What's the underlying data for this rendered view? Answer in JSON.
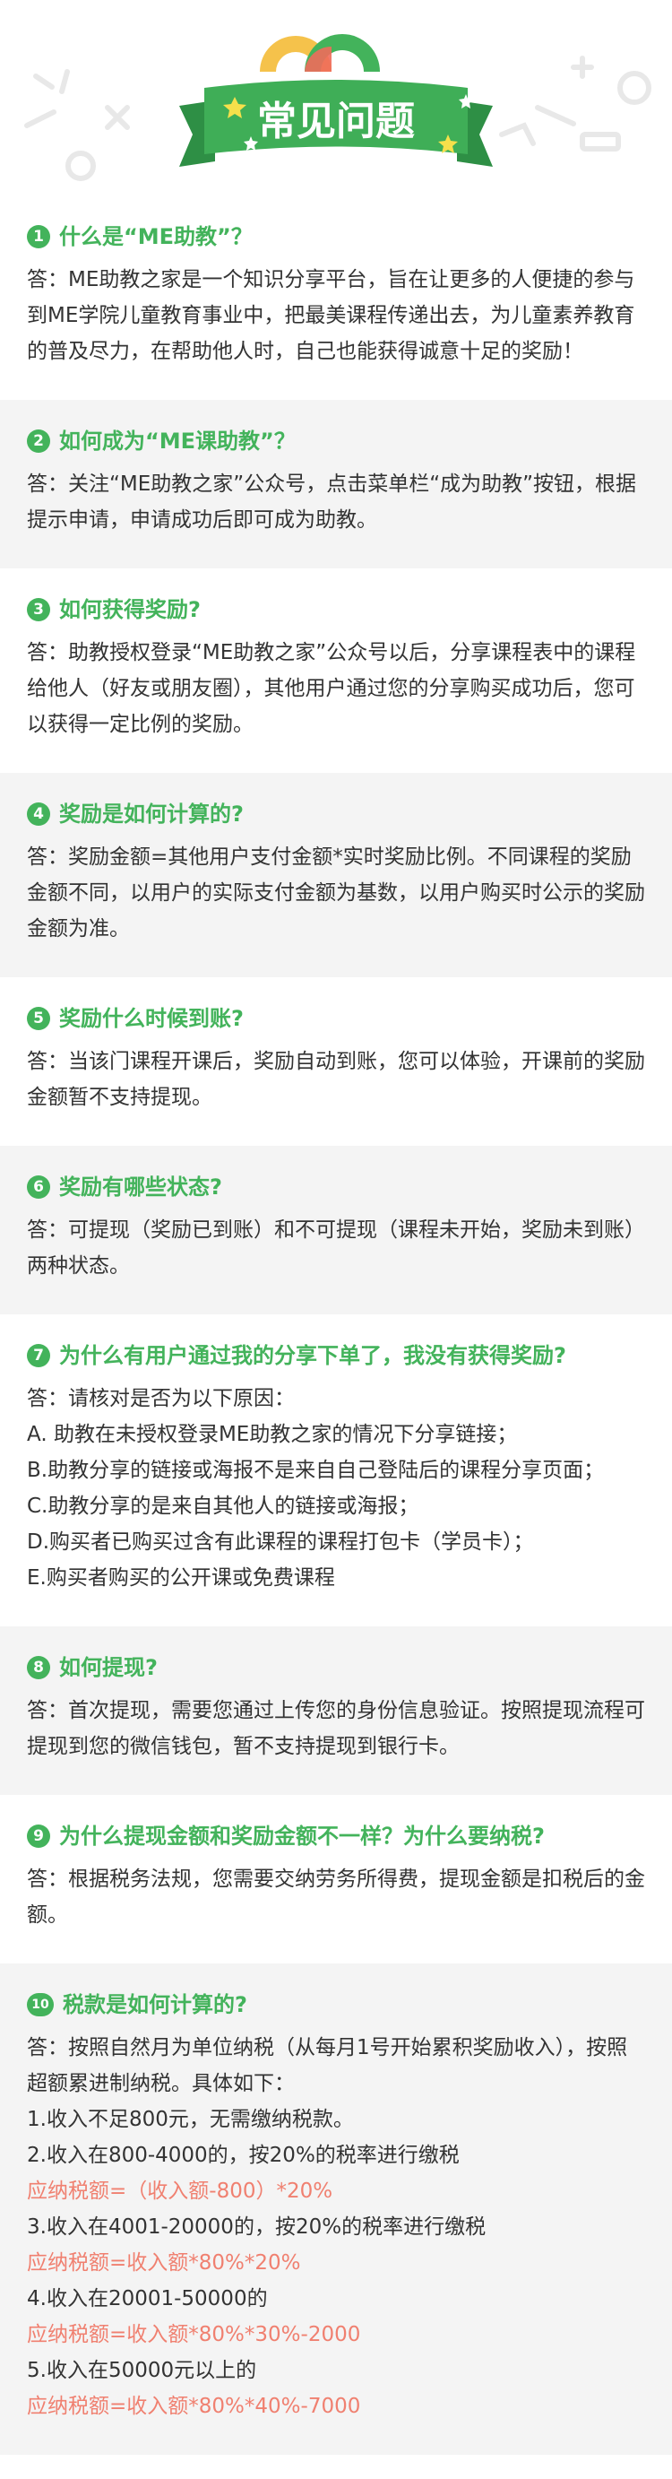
{
  "colors": {
    "accent": "#43b35b",
    "formula": "#f08070",
    "banner": "#3fae57",
    "grey_bg": "#f4f4f4"
  },
  "header": {
    "title": "常见问题"
  },
  "faqs": [
    {
      "num": "1",
      "q": "什么是“ME助教”？",
      "a": [
        "答：ME助教之家是一个知识分享平台，旨在让更多的人便捷的参与到ME学院儿童教育事业中，把最美课程传递出去，为儿童素养教育的普及尽力，在帮助他人时，自己也能获得诚意十足的奖励！"
      ]
    },
    {
      "num": "2",
      "q": "如何成为“ME课助教”？",
      "a": [
        "答：关注“ME助教之家”公众号，点击菜单栏“成为助教”按钮，根据提示申请，申请成功后即可成为助教。"
      ]
    },
    {
      "num": "3",
      "q": "如何获得奖励?",
      "a": [
        "答：助教授权登录“ME助教之家”公众号以后，分享课程表中的课程给他人（好友或朋友圈），其他用户通过您的分享购买成功后，您可以获得一定比例的奖励。"
      ]
    },
    {
      "num": "4",
      "q": "奖励是如何计算的?",
      "a": [
        "答：奖励金额=其他用户支付金额*实时奖励比例。不同课程的奖励金额不同，以用户的实际支付金额为基数，以用户购买时公示的奖励金额为准。"
      ]
    },
    {
      "num": "5",
      "q": "奖励什么时候到账?",
      "a": [
        "答：当该门课程开课后，奖励自动到账，您可以体验，开课前的奖励金额暂不支持提现。"
      ]
    },
    {
      "num": "6",
      "q": "奖励有哪些状态?",
      "a": [
        "答：可提现（奖励已到账）和不可提现（课程未开始，奖励未到账）两种状态。"
      ]
    },
    {
      "num": "7",
      "q": "为什么有用户通过我的分享下单了，我没有获得奖励?",
      "a": [
        "答：请核对是否为以下原因：",
        "A. 助教在未授权登录ME助教之家的情况下分享链接；",
        "B.助教分享的链接或海报不是来自自己登陆后的课程分享页面；",
        "C.助教分享的是来自其他人的链接或海报；",
        "D.购买者已购买过含有此课程的课程打包卡（学员卡）；",
        "E.购买者购买的公开课或免费课程"
      ]
    },
    {
      "num": "8",
      "q": "如何提现?",
      "a": [
        "答：首次提现，需要您通过上传您的身份信息验证。按照提现流程可提现到您的微信钱包，暂不支持提现到银行卡。"
      ]
    },
    {
      "num": "9",
      "q": "为什么提现金额和奖励金额不一样？为什么要纳税?",
      "a": [
        "答：根据税务法规，您需要交纳劳务所得费，提现金额是扣税后的金额。"
      ]
    },
    {
      "num": "10",
      "q": "税款是如何计算的?",
      "a": [
        "答：按照自然月为单位纳税（从每月1号开始累积奖励收入），按照超额累进制纳税。具体如下：",
        "1.收入不足800元，无需缴纳税款。",
        "2.收入在800-4000的，按20%的税率进行缴税"
      ],
      "rules": [
        {
          "formula": "应纳税额=（收入额-800）*20%",
          "next": "3.收入在4001-20000的，按20%的税率进行缴税"
        },
        {
          "formula": "应纳税额=收入额*80%*20%",
          "next": "4.收入在20001-50000的"
        },
        {
          "formula": "应纳税额=收入额*80%*30%-2000",
          "next": "5.收入在50000元以上的"
        },
        {
          "formula": "应纳税额=收入额*80%*40%-7000",
          "next": ""
        }
      ]
    }
  ]
}
